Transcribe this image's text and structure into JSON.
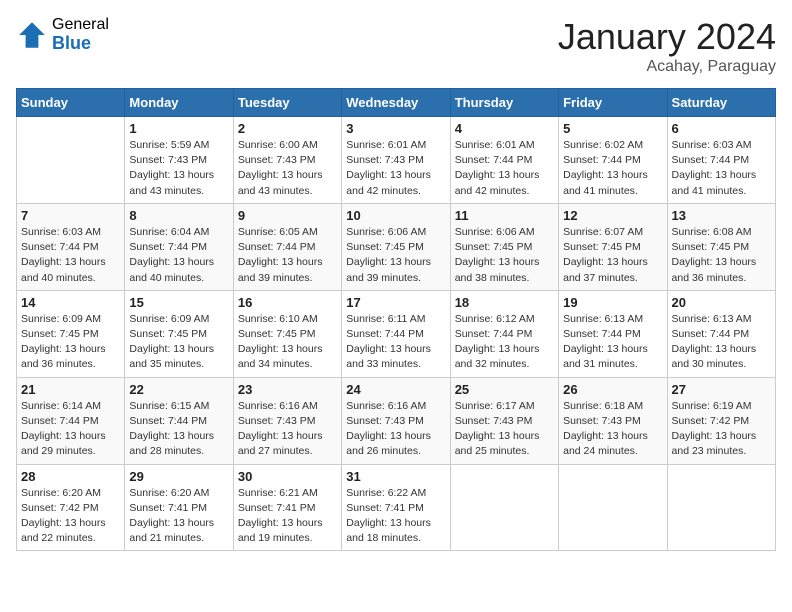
{
  "header": {
    "logo_general": "General",
    "logo_blue": "Blue",
    "title": "January 2024",
    "location": "Acahay, Paraguay"
  },
  "weekdays": [
    "Sunday",
    "Monday",
    "Tuesday",
    "Wednesday",
    "Thursday",
    "Friday",
    "Saturday"
  ],
  "weeks": [
    [
      {
        "day": "",
        "info": ""
      },
      {
        "day": "1",
        "info": "Sunrise: 5:59 AM\nSunset: 7:43 PM\nDaylight: 13 hours\nand 43 minutes."
      },
      {
        "day": "2",
        "info": "Sunrise: 6:00 AM\nSunset: 7:43 PM\nDaylight: 13 hours\nand 43 minutes."
      },
      {
        "day": "3",
        "info": "Sunrise: 6:01 AM\nSunset: 7:43 PM\nDaylight: 13 hours\nand 42 minutes."
      },
      {
        "day": "4",
        "info": "Sunrise: 6:01 AM\nSunset: 7:44 PM\nDaylight: 13 hours\nand 42 minutes."
      },
      {
        "day": "5",
        "info": "Sunrise: 6:02 AM\nSunset: 7:44 PM\nDaylight: 13 hours\nand 41 minutes."
      },
      {
        "day": "6",
        "info": "Sunrise: 6:03 AM\nSunset: 7:44 PM\nDaylight: 13 hours\nand 41 minutes."
      }
    ],
    [
      {
        "day": "7",
        "info": "Sunrise: 6:03 AM\nSunset: 7:44 PM\nDaylight: 13 hours\nand 40 minutes."
      },
      {
        "day": "8",
        "info": "Sunrise: 6:04 AM\nSunset: 7:44 PM\nDaylight: 13 hours\nand 40 minutes."
      },
      {
        "day": "9",
        "info": "Sunrise: 6:05 AM\nSunset: 7:44 PM\nDaylight: 13 hours\nand 39 minutes."
      },
      {
        "day": "10",
        "info": "Sunrise: 6:06 AM\nSunset: 7:45 PM\nDaylight: 13 hours\nand 39 minutes."
      },
      {
        "day": "11",
        "info": "Sunrise: 6:06 AM\nSunset: 7:45 PM\nDaylight: 13 hours\nand 38 minutes."
      },
      {
        "day": "12",
        "info": "Sunrise: 6:07 AM\nSunset: 7:45 PM\nDaylight: 13 hours\nand 37 minutes."
      },
      {
        "day": "13",
        "info": "Sunrise: 6:08 AM\nSunset: 7:45 PM\nDaylight: 13 hours\nand 36 minutes."
      }
    ],
    [
      {
        "day": "14",
        "info": "Sunrise: 6:09 AM\nSunset: 7:45 PM\nDaylight: 13 hours\nand 36 minutes."
      },
      {
        "day": "15",
        "info": "Sunrise: 6:09 AM\nSunset: 7:45 PM\nDaylight: 13 hours\nand 35 minutes."
      },
      {
        "day": "16",
        "info": "Sunrise: 6:10 AM\nSunset: 7:45 PM\nDaylight: 13 hours\nand 34 minutes."
      },
      {
        "day": "17",
        "info": "Sunrise: 6:11 AM\nSunset: 7:44 PM\nDaylight: 13 hours\nand 33 minutes."
      },
      {
        "day": "18",
        "info": "Sunrise: 6:12 AM\nSunset: 7:44 PM\nDaylight: 13 hours\nand 32 minutes."
      },
      {
        "day": "19",
        "info": "Sunrise: 6:13 AM\nSunset: 7:44 PM\nDaylight: 13 hours\nand 31 minutes."
      },
      {
        "day": "20",
        "info": "Sunrise: 6:13 AM\nSunset: 7:44 PM\nDaylight: 13 hours\nand 30 minutes."
      }
    ],
    [
      {
        "day": "21",
        "info": "Sunrise: 6:14 AM\nSunset: 7:44 PM\nDaylight: 13 hours\nand 29 minutes."
      },
      {
        "day": "22",
        "info": "Sunrise: 6:15 AM\nSunset: 7:44 PM\nDaylight: 13 hours\nand 28 minutes."
      },
      {
        "day": "23",
        "info": "Sunrise: 6:16 AM\nSunset: 7:43 PM\nDaylight: 13 hours\nand 27 minutes."
      },
      {
        "day": "24",
        "info": "Sunrise: 6:16 AM\nSunset: 7:43 PM\nDaylight: 13 hours\nand 26 minutes."
      },
      {
        "day": "25",
        "info": "Sunrise: 6:17 AM\nSunset: 7:43 PM\nDaylight: 13 hours\nand 25 minutes."
      },
      {
        "day": "26",
        "info": "Sunrise: 6:18 AM\nSunset: 7:43 PM\nDaylight: 13 hours\nand 24 minutes."
      },
      {
        "day": "27",
        "info": "Sunrise: 6:19 AM\nSunset: 7:42 PM\nDaylight: 13 hours\nand 23 minutes."
      }
    ],
    [
      {
        "day": "28",
        "info": "Sunrise: 6:20 AM\nSunset: 7:42 PM\nDaylight: 13 hours\nand 22 minutes."
      },
      {
        "day": "29",
        "info": "Sunrise: 6:20 AM\nSunset: 7:41 PM\nDaylight: 13 hours\nand 21 minutes."
      },
      {
        "day": "30",
        "info": "Sunrise: 6:21 AM\nSunset: 7:41 PM\nDaylight: 13 hours\nand 19 minutes."
      },
      {
        "day": "31",
        "info": "Sunrise: 6:22 AM\nSunset: 7:41 PM\nDaylight: 13 hours\nand 18 minutes."
      },
      {
        "day": "",
        "info": ""
      },
      {
        "day": "",
        "info": ""
      },
      {
        "day": "",
        "info": ""
      }
    ]
  ]
}
